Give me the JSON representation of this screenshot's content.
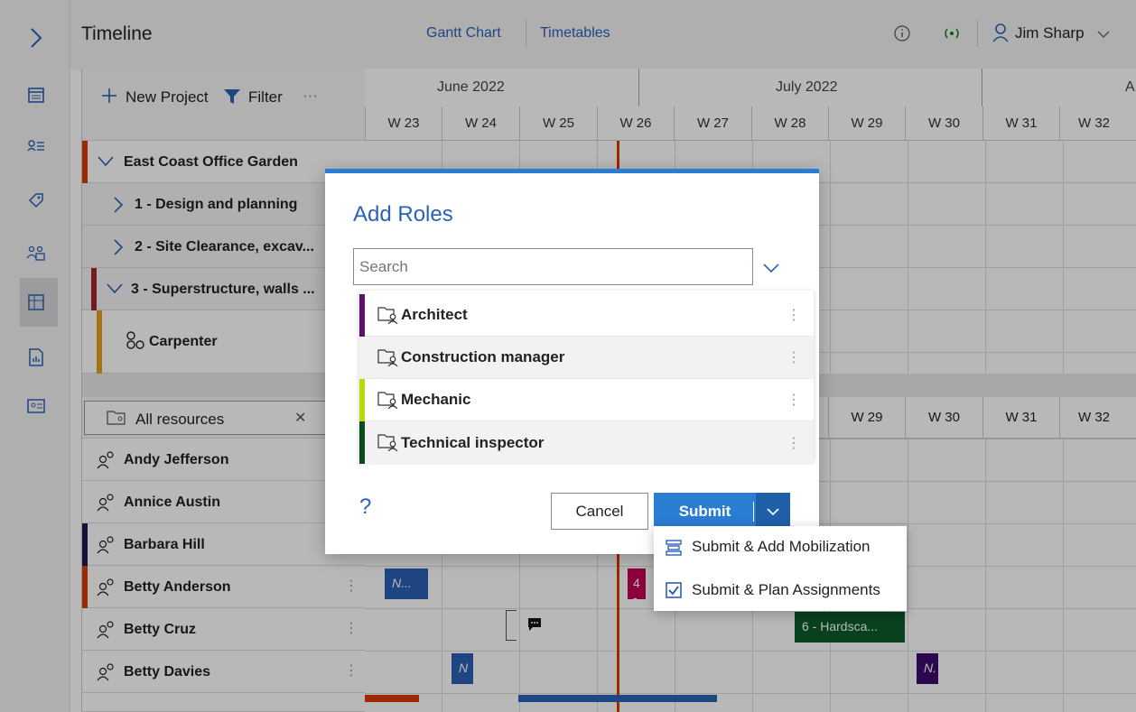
{
  "topbar": {
    "title": "Timeline",
    "tabs": [
      {
        "label": "Gantt Chart"
      },
      {
        "label": "Timetables"
      }
    ],
    "user_name": "Jim Sharp"
  },
  "toolbar": {
    "new_project": "New Project",
    "filter": "Filter",
    "more": "···"
  },
  "timeline": {
    "months": [
      "June 2022",
      "July 2022",
      "A"
    ],
    "weeks": [
      "W 23",
      "W 24",
      "W 25",
      "W 26",
      "W 27",
      "W 28",
      "W 29",
      "W 30",
      "W 31",
      "W 32"
    ],
    "lower_weeks": [
      "W 29",
      "W 30",
      "W 31",
      "W 32"
    ]
  },
  "projects": [
    {
      "label": "East Coast Office Garden",
      "color": "#d83b01"
    },
    {
      "label": "1 - Design and planning"
    },
    {
      "label": "2 - Site Clearance, excav..."
    },
    {
      "label": "3 - Superstructure, walls ...",
      "color": "#a4262c"
    },
    {
      "label": "Carpenter",
      "color": "#e3a21a"
    }
  ],
  "resources": {
    "header": "All resources",
    "items": [
      {
        "label": "Andy Jefferson"
      },
      {
        "label": "Annice Austin"
      },
      {
        "label": "Barbara Hill",
        "color": "#1b1a4e"
      },
      {
        "label": "Betty Anderson",
        "color": "#d83b01"
      },
      {
        "label": "Betty Cruz"
      },
      {
        "label": "Betty Davies"
      }
    ]
  },
  "bars": [
    {
      "label": "N...",
      "color": "#2b62b6"
    },
    {
      "label": "4 -",
      "color": "#c30052"
    },
    {
      "label": "6 - Hardsca...",
      "color": "#0b5a2a"
    },
    {
      "label": "N",
      "color": "#2b62b6"
    },
    {
      "label": "N.",
      "color": "#3b0a6e"
    }
  ],
  "dialog": {
    "title": "Add Roles",
    "search_placeholder": "Search",
    "roles": [
      {
        "label": "Architect",
        "color": "#5c126b"
      },
      {
        "label": "Construction manager",
        "color": ""
      },
      {
        "label": "Mechanic",
        "color": "#bad80a"
      },
      {
        "label": "Technical inspector",
        "color": "#0b4a1e"
      }
    ],
    "help": "?",
    "cancel": "Cancel",
    "submit": "Submit"
  },
  "submit_menu": {
    "items": [
      {
        "label": "Submit & Add Mobilization"
      },
      {
        "label": "Submit & Plan Assignments"
      }
    ]
  },
  "colors": {
    "accent": "#2b7cd3",
    "today_line": "#d83b01"
  }
}
